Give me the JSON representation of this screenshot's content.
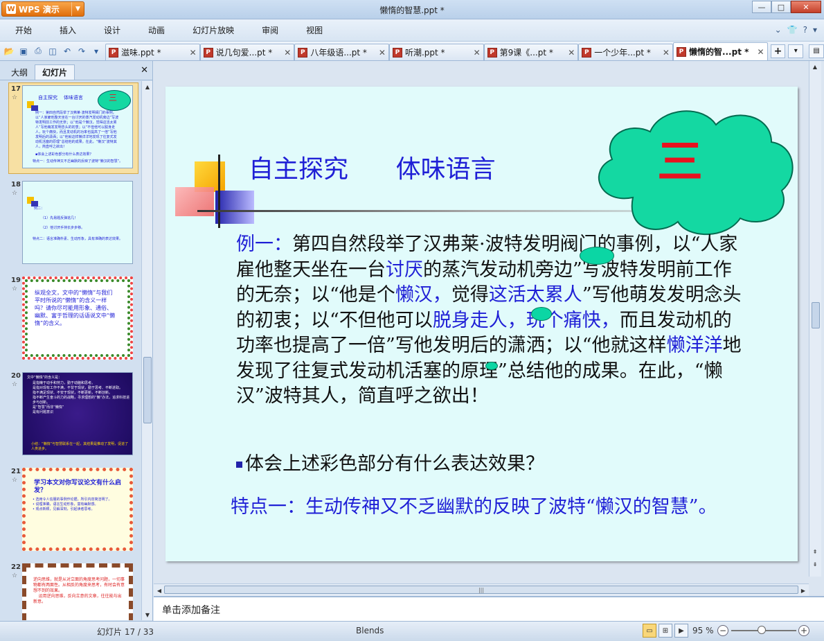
{
  "app": {
    "button_label": "WPS 演示",
    "window_title": "懒惰的智慧.ppt *"
  },
  "window_controls": {
    "minimize": "—",
    "maximize": "□",
    "close": "✕"
  },
  "menu": {
    "items": [
      "开始",
      "插入",
      "设计",
      "动画",
      "幻灯片放映",
      "审阅",
      "视图"
    ]
  },
  "tabs": [
    {
      "label": "滋味.ppt *",
      "active": false
    },
    {
      "label": "说几句爱...pt *",
      "active": false
    },
    {
      "label": "八年级语...pt *",
      "active": false
    },
    {
      "label": "听潮.ppt *",
      "active": false
    },
    {
      "label": "第9课《...pt *",
      "active": false
    },
    {
      "label": "一个少年...pt *",
      "active": false
    },
    {
      "label": "懒惰的智...pt *",
      "active": true
    }
  ],
  "left_panel": {
    "tabs": [
      "大纲",
      "幻灯片"
    ],
    "active_tab": "幻灯片"
  },
  "thumbnails": [
    {
      "num": "17",
      "selected": true
    },
    {
      "num": "18",
      "selected": false
    },
    {
      "num": "19",
      "selected": false
    },
    {
      "num": "20",
      "selected": false
    },
    {
      "num": "21",
      "selected": false
    },
    {
      "num": "22",
      "selected": false
    }
  ],
  "thumb_text": {
    "t17_title": "自主探究    体味语言",
    "t17_num": "三",
    "t17_body": "例一：第四自然段举了汉弗莱·波特发明阀门的事例，以“人家雇他整天坐在一台讨厌的蒸汽发动机旁边”写波特发明前工作的无奈；以“他是个懒汉，觉得这活太累人”写他萌发发明念头的初衷；以“不但他可以脱身走人，玩个痛快，而且发动机的功率也提高了一倍”写他发明后的潇洒；以“他就这样懒洋洋地发现了往复式发动机活塞的原理”总结他的成果。在此，“懒汉”波特其人，简直呼之欲出！",
    "t17_q": "▪体会上述彩色部分有什么表达效果？",
    "t17_feature": "特点一：生动传神又不乏幽默的反映了波特“懒汉的智慧”。",
    "t18_title": "例二：",
    "t18_l1": "（1）先易题反弹逃几！",
    "t18_l2": "（2）他讨厌手持长步步移。",
    "t18_l3": "特点二：语言准确朴素、生动形象，具有准确的表达效果。",
    "t19_body": "纵观全文，文中的“懒惰”与我们平时所说的“懒惰”的含义一样吗？请你尽可能用形象、通俗、幽默、富于哲理的话语说文中“懒惰”的含义。",
    "t20_title": "文中“懒惰”的含义是：",
    "t20_body": "是指懒于动手和劳力，勤于动脑和思考。\n是指对现有工作不满，不甘于现状，勤于思考、不断进取。\n指不满足现状、不安于现状，不断更新，不断创新。\n指不断产生奋斗的力的战略，寻求理想的“懒”办法，追求科技进步与创新。\n是“智慧”而非“懒惰”\n是有问题意识",
    "t20_foot": "小结：“懒惰”与智慧联系在一起，其结果是推动了发明，促进了人类进步。",
    "t21_title": "学习本文对你写议论文有什么启发？",
    "t21_body": "• 选用令人信服的事例作论据，所引内容简洁明了。\n• 说理准确，语言生动形象，富有幽默感。\n• 观点新颖，见解深刻，引起读者思考。",
    "t22_body": "逆向思维，就是从对立面的角度思考问题，一切事物都有两面性。从相反的角度来思考，有时会有意想不到的效果。\n    运用逆向思维，反向立意的文章，往往能与出新意。"
  },
  "slide": {
    "title": "自主探究      体味语言",
    "cloud_text": "三",
    "para_1": "例一：",
    "para_2": "第四自然段举了汉弗莱·波特发明阀门的事例，以“人家雇他整天坐在一台",
    "para_3": "讨厌",
    "para_4": "的蒸汽发动机旁边”写波特发明前工作的无奈；以“他是个",
    "para_5": "懒汉，",
    "para_6": "觉得",
    "para_7": "这活太累人",
    "para_8": "”写他萌发发明念头的初衷；以“不但他可以",
    "para_9": "脱身走人，玩个痛快，",
    "para_10": "而且发动机的功率也提高了一倍”写他发明后的潇洒；以“他就这样",
    "para_11": "懒洋洋",
    "para_12": "地发现了往复式发动机活塞的原理”总结他的成果。在此，“懒汉”波特其人，简直呼之欲出！",
    "question": "体会上述彩色部分有什么表达效果？",
    "feature": "特点一：生动传神又不乏幽默的反映了波特“懒汉的智慧”。"
  },
  "notes_placeholder": "单击添加备注",
  "status": {
    "slide_info": "幻灯片 17 / 33",
    "theme": "Blends",
    "zoom": "95 %"
  },
  "colors": {
    "slide_bg": "#e1fbfb",
    "title_blue": "#1f1fd6",
    "cloud_green": "#14d8a2",
    "cloud_text_red": "#e8121f",
    "selected_thumb": "#f7e0a3"
  }
}
